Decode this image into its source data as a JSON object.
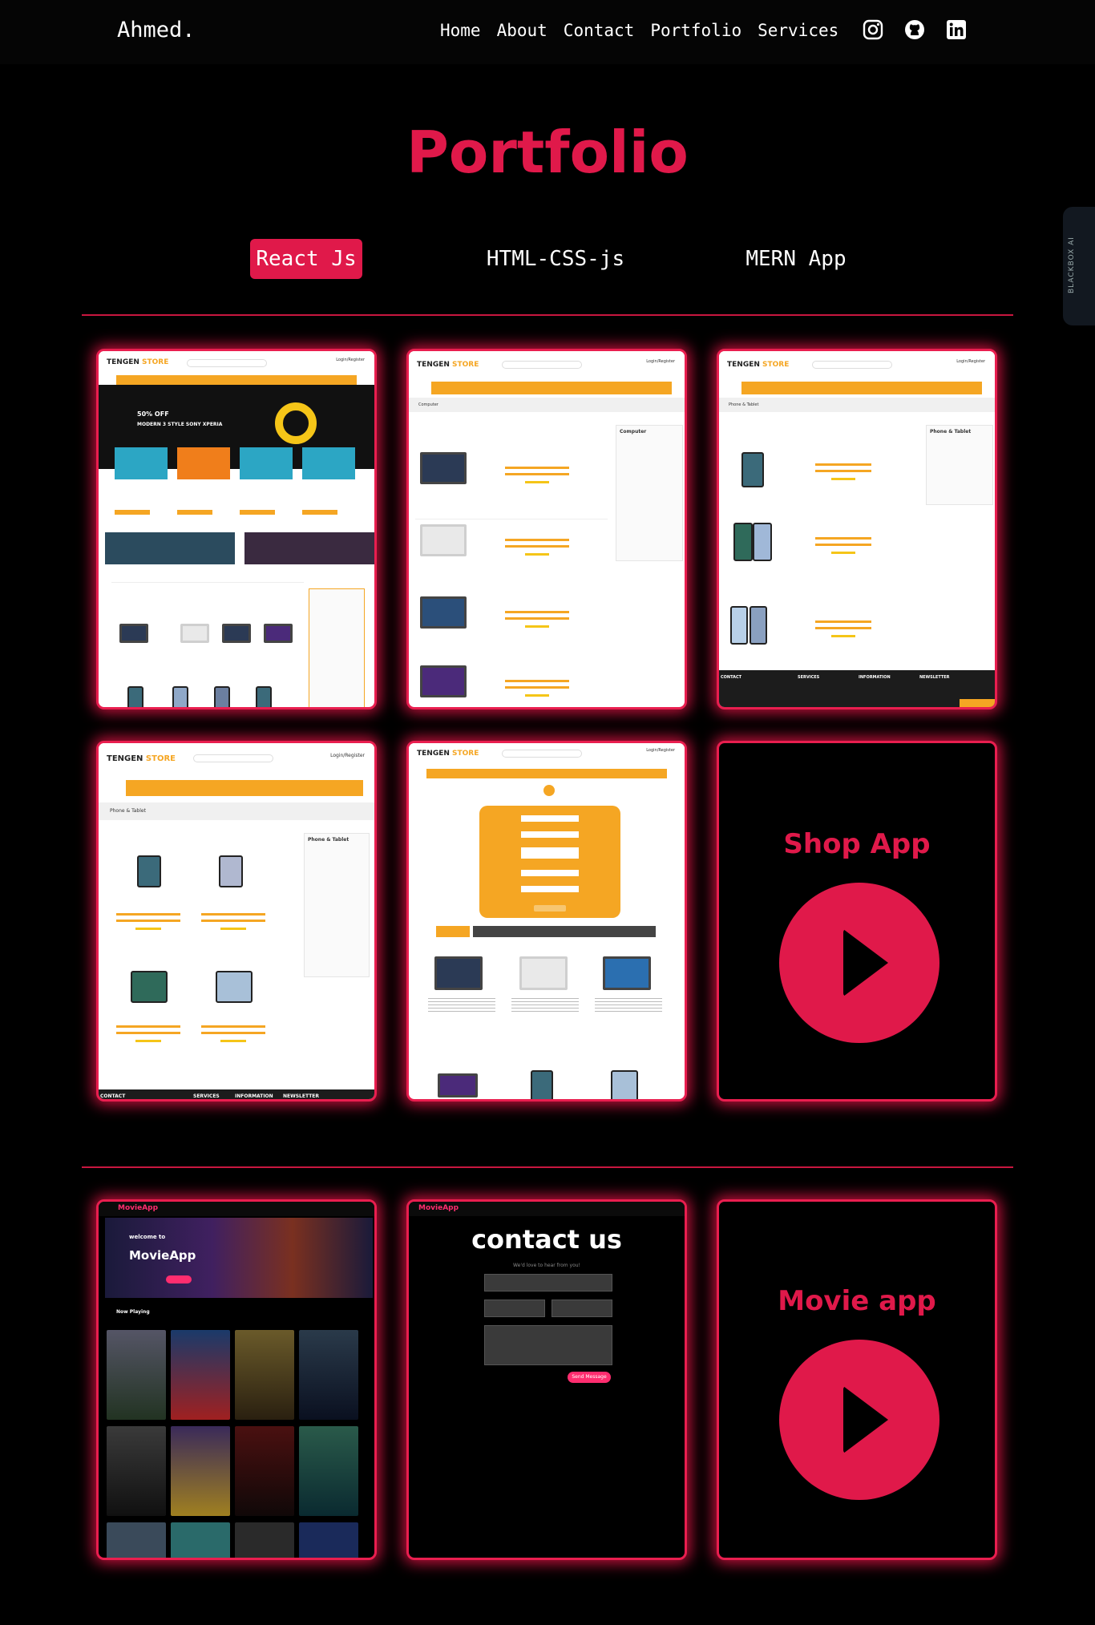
{
  "nav": {
    "logo": "Ahmed.",
    "links": [
      "Home",
      "About",
      "Contact",
      "Portfolio",
      "Services"
    ],
    "icons": [
      "instagram-icon",
      "github-icon",
      "linkedin-icon"
    ]
  },
  "page_title": "Portfolio",
  "tabs": [
    {
      "label": "React Js",
      "active": true
    },
    {
      "label": "HTML-CSS-js",
      "active": false
    },
    {
      "label": "MERN App",
      "active": false
    }
  ],
  "cards": {
    "shop_app_title": "Shop App",
    "movie_app_title": "Movie app"
  },
  "store_mock": {
    "logo_a": "TENGEN",
    "logo_b": "STORE",
    "login": "Login/Register",
    "computer": "Computer",
    "phone_tablet": "Phone & Tablet",
    "contact": "CONTACT",
    "services": "SERVICES",
    "information": "INFORMATION",
    "newsletter": "NEWSLETTER"
  },
  "movie_mock": {
    "logo": "MovieApp",
    "hero_welcome": "welcome to",
    "hero_title": "MovieApp",
    "now_playing": "Now Playing",
    "contact_title": "contact us",
    "contact_sub": "We'd love to hear from you!",
    "send": "Send Message"
  },
  "side_widget": "BLACKBOX AI",
  "colors": {
    "accent": "#e0194a",
    "store_orange": "#f5a623"
  }
}
